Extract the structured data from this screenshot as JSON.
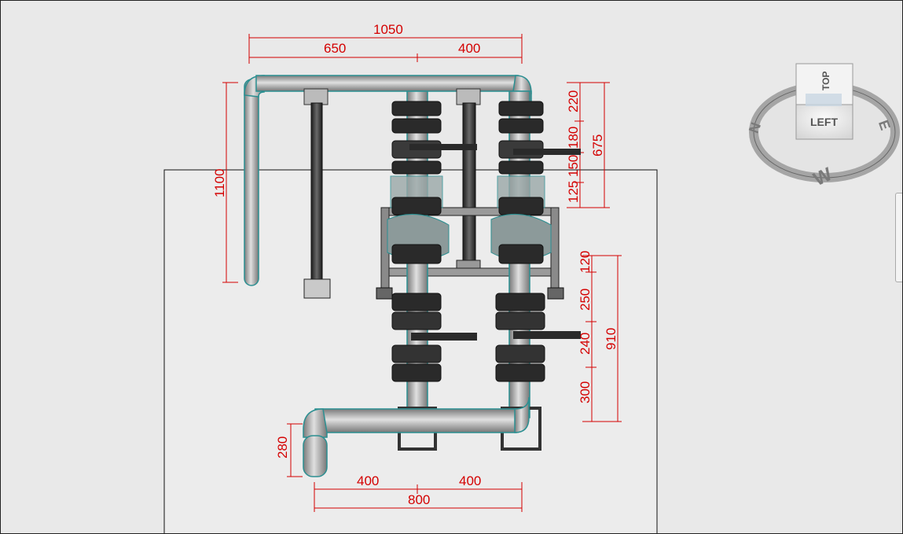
{
  "view_cube": {
    "front_face": "LEFT",
    "top_face": "TOP",
    "compass": {
      "north": "N",
      "east": "E",
      "west": "W"
    }
  },
  "dimensions": {
    "top_total": "1050",
    "top_left": "650",
    "top_right": "400",
    "left_height": "1100",
    "right_stack": [
      "220",
      "180",
      "150",
      "125"
    ],
    "right_total_upper": "675",
    "lower_stack": [
      "120",
      "250",
      "240",
      "300"
    ],
    "lower_total": "910",
    "bottom_vertical": "280",
    "bottom_left": "400",
    "bottom_right": "400",
    "bottom_total": "800"
  },
  "colors": {
    "dimension": "#d40000",
    "pipe_fill": "#b4b4b4",
    "pipe_outline": "#2b8f91",
    "background": "#e9e9e9",
    "floor": "#ececec"
  }
}
